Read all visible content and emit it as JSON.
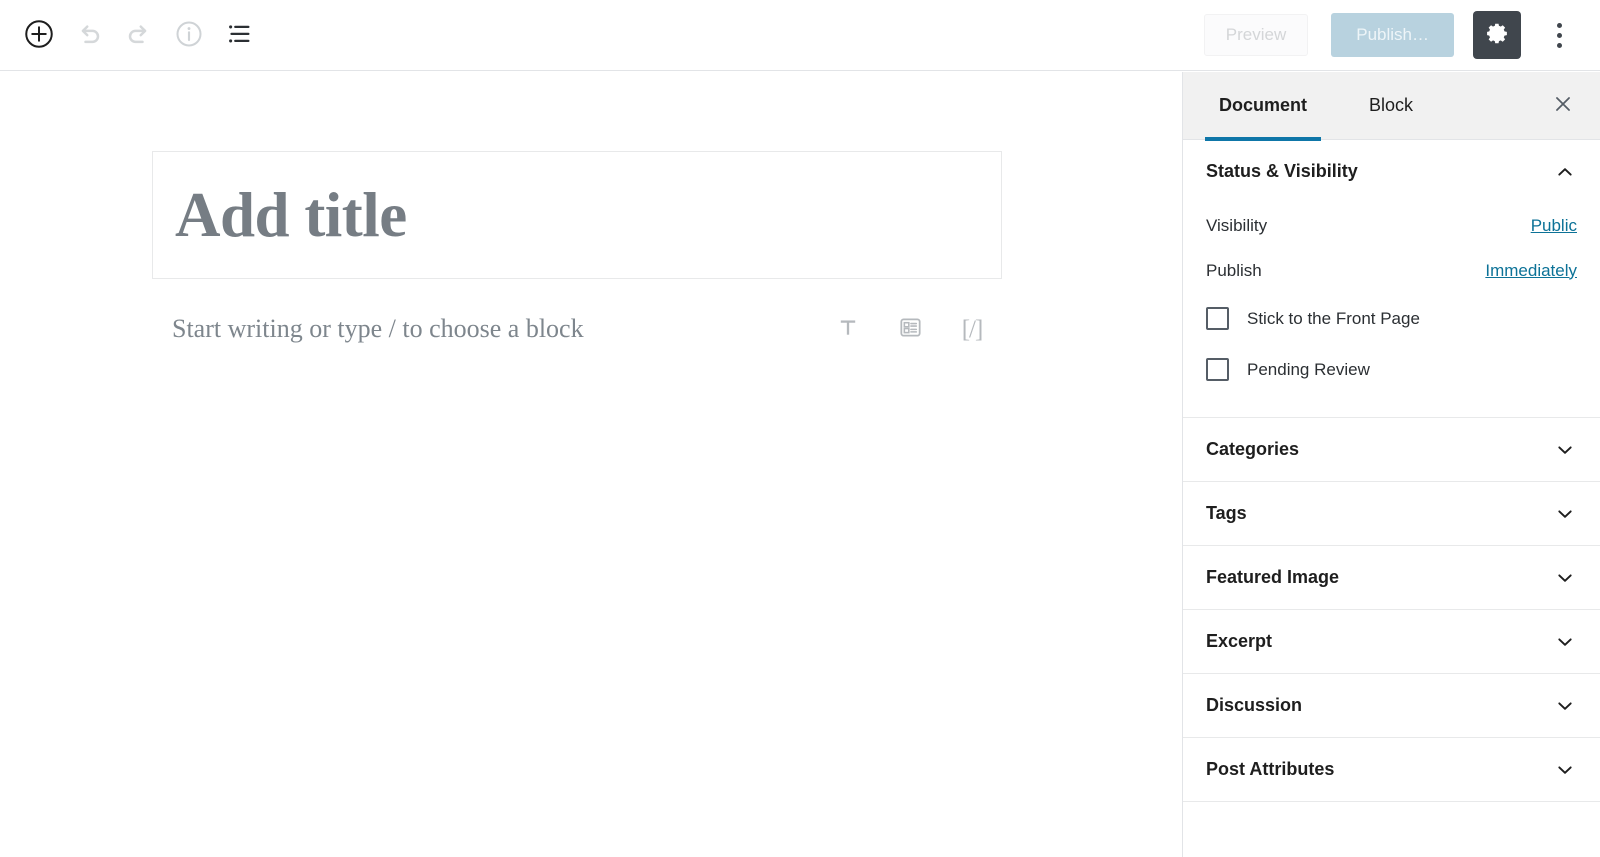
{
  "header": {
    "tools": [
      {
        "name": "add-block-icon",
        "label": "Add block"
      },
      {
        "name": "undo-icon",
        "label": "Undo"
      },
      {
        "name": "redo-icon",
        "label": "Redo"
      },
      {
        "name": "content-info-icon",
        "label": "Content structure"
      },
      {
        "name": "block-navigation-icon",
        "label": "Block navigation"
      }
    ],
    "preview_label": "Preview",
    "publish_label": "Publish…",
    "settings_label": "Settings",
    "more_label": "More tools & options"
  },
  "editor": {
    "title_placeholder": "Add title",
    "block_placeholder": "Start writing or type / to choose a block",
    "shortcuts": [
      {
        "name": "paragraph-icon",
        "label": "Paragraph"
      },
      {
        "name": "media-text-icon",
        "label": "Media & Text"
      },
      {
        "name": "shortcode-icon",
        "label": "[/]"
      }
    ]
  },
  "sidebar": {
    "tabs": [
      {
        "label": "Document",
        "active": true
      },
      {
        "label": "Block",
        "active": false
      }
    ],
    "close_label": "Close settings",
    "panels": [
      {
        "title": "Status & Visibility",
        "expanded": true,
        "chevron": "up"
      },
      {
        "title": "Categories",
        "expanded": false,
        "chevron": "down"
      },
      {
        "title": "Tags",
        "expanded": false,
        "chevron": "down"
      },
      {
        "title": "Featured Image",
        "expanded": false,
        "chevron": "down"
      },
      {
        "title": "Excerpt",
        "expanded": false,
        "chevron": "down"
      },
      {
        "title": "Discussion",
        "expanded": false,
        "chevron": "down"
      },
      {
        "title": "Post Attributes",
        "expanded": false,
        "chevron": "down"
      }
    ],
    "status": {
      "visibility_label": "Visibility",
      "visibility_value": "Public",
      "publish_label": "Publish",
      "publish_value": "Immediately",
      "sticky_label": "Stick to the Front Page",
      "sticky_checked": false,
      "pending_label": "Pending Review",
      "pending_checked": false
    }
  },
  "colors": {
    "accent_blue": "#0e76a8",
    "link_blue": "#0c7297",
    "publish_bg": "#b8d2df",
    "settings_bg": "#40464d",
    "border": "#e2e4e7",
    "title_gray": "#767d84"
  }
}
